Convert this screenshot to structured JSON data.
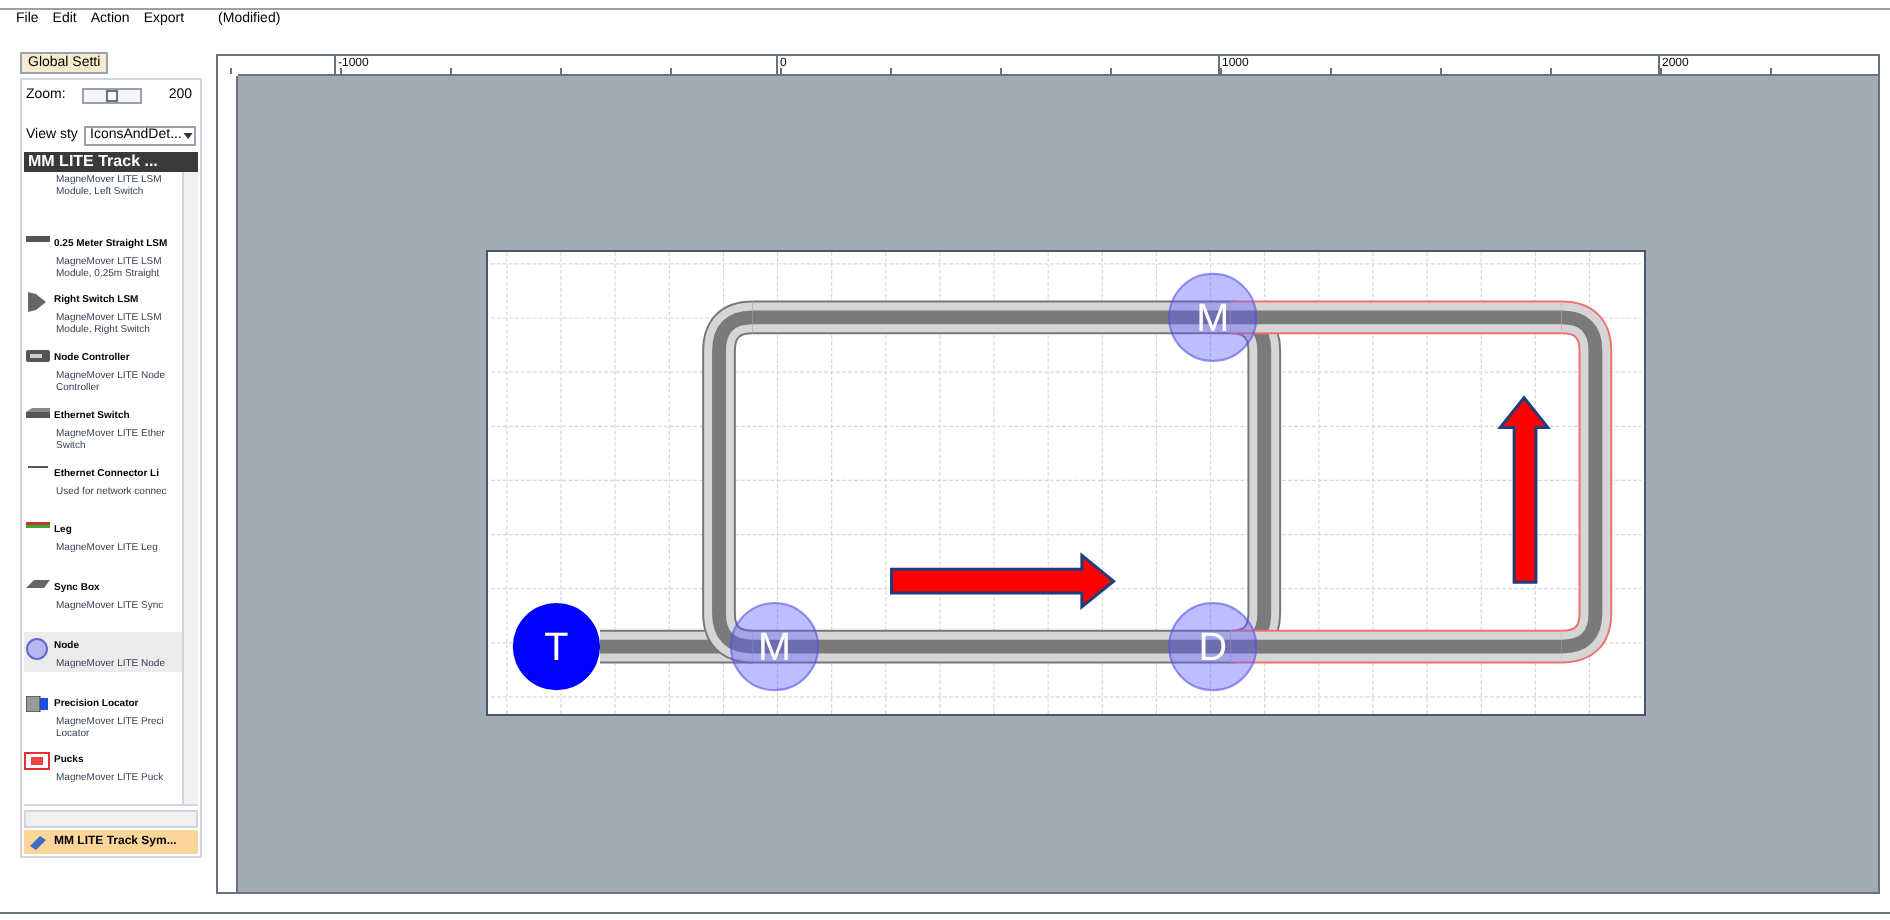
{
  "menu": [
    "File",
    "Edit",
    "Action",
    "Export"
  ],
  "document_state": "(Modified)",
  "global_settings_tab": "Global Setti",
  "zoom": {
    "label": "Zoom:",
    "value": "200",
    "level": 0.5
  },
  "view_style": {
    "label": "View sty",
    "value": "IconsAndDet..."
  },
  "palette": {
    "title": "MM LITE Track ...",
    "items": [
      {
        "kind": "none",
        "description": [
          "MagneMover LITE LSM",
          "Module, Left Switch"
        ],
        "selected": false
      },
      {
        "kind": "straight",
        "name": "0.25 Meter Straight LSM",
        "description": [
          "MagneMover LITE LSM",
          "Module, 0.25m Straight"
        ],
        "selected": false
      },
      {
        "kind": "switch",
        "name": "Right Switch LSM",
        "description": [
          "MagneMover LITE LSM",
          "Module, Right Switch"
        ],
        "selected": false
      },
      {
        "kind": "controller",
        "name": "Node Controller",
        "description": [
          "MagneMover LITE Node",
          "Controller"
        ],
        "selected": false
      },
      {
        "kind": "ethernet",
        "name": "Ethernet Switch",
        "description": [
          "MagneMover LITE Ether",
          "Switch"
        ],
        "selected": false
      },
      {
        "kind": "line",
        "name": "Ethernet Connector Li",
        "description": [
          "Used for network connec"
        ],
        "selected": false
      },
      {
        "kind": "leg",
        "name": "Leg",
        "description": [
          "MagneMover LITE Leg"
        ],
        "selected": false
      },
      {
        "kind": "syncbox",
        "name": "Sync Box",
        "description": [
          "MagneMover LITE Sync"
        ],
        "selected": false
      },
      {
        "kind": "node",
        "name": "Node",
        "description": [
          "MagneMover LITE Node"
        ],
        "selected": true
      },
      {
        "kind": "locator",
        "name": "Precision Locator",
        "description": [
          "MagneMover LITE Preci",
          "Locator"
        ],
        "selected": false
      },
      {
        "kind": "pucks",
        "name": "Pucks",
        "description": [
          "MagneMover LITE Puck"
        ],
        "selected": false
      }
    ],
    "footer": "MM LITE Track Sym..."
  },
  "ruler": [
    "-1000",
    "0",
    "1000",
    "2000"
  ],
  "diagram": {
    "nodes": [
      {
        "kind": "terminal",
        "label": "T"
      },
      {
        "kind": "marker",
        "label": "M"
      },
      {
        "kind": "marker",
        "label": "M"
      },
      {
        "kind": "marker",
        "label": "D"
      }
    ],
    "arrows": [
      {
        "kind": "right"
      },
      {
        "kind": "up"
      }
    ]
  }
}
